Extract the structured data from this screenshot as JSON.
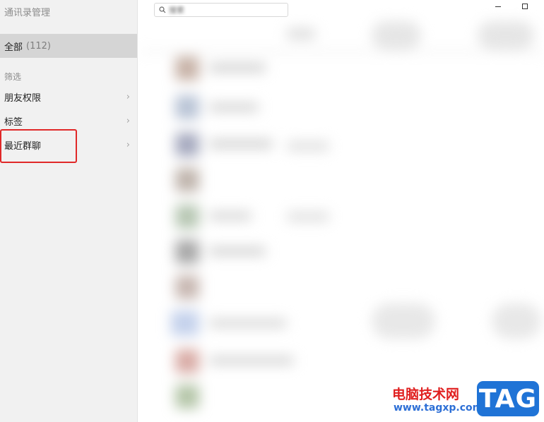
{
  "app": {
    "title": "通讯录管理"
  },
  "sidebar": {
    "all": {
      "label": "全部",
      "count": "(112)"
    },
    "filter_label": "筛选",
    "items": [
      {
        "label": "朋友权限"
      },
      {
        "label": "标签"
      },
      {
        "label": "最近群聊"
      }
    ]
  },
  "main": {
    "search": {
      "placeholder": "搜索"
    }
  },
  "watermark": {
    "title": "电脑技术网",
    "url": "www.tagxp.com",
    "badge": "TAG"
  },
  "colors": {
    "highlight": "#e02828",
    "selected_bg": "#d5d5d5",
    "watermark_blue": "#1f73d6",
    "watermark_red": "#e02020"
  }
}
